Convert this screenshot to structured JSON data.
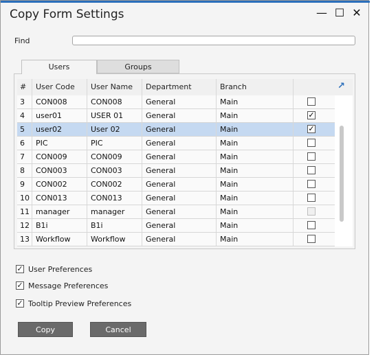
{
  "window": {
    "title": "Copy Form Settings",
    "min_glyph": "—",
    "max_glyph": "☐",
    "close_glyph": "✕"
  },
  "find": {
    "label": "Find",
    "value": ""
  },
  "tabs": [
    {
      "label": "Users",
      "active": true
    },
    {
      "label": "Groups",
      "active": false
    }
  ],
  "grid": {
    "columns": [
      "#",
      "User Code",
      "User Name",
      "Department",
      "Branch",
      ""
    ],
    "rows": [
      {
        "num": "3",
        "code": "CON008",
        "name": "CON008",
        "dept": "General",
        "branch": "Main",
        "checked": "",
        "selected": false,
        "disabled": false
      },
      {
        "num": "4",
        "code": "user01",
        "name": "USER 01",
        "dept": "General",
        "branch": "Main",
        "checked": "✓",
        "selected": false,
        "disabled": false
      },
      {
        "num": "5",
        "code": "user02",
        "name": "User 02",
        "dept": "General",
        "branch": "Main",
        "checked": "✓",
        "selected": true,
        "disabled": false
      },
      {
        "num": "6",
        "code": "PIC",
        "name": "PIC",
        "dept": "General",
        "branch": "Main",
        "checked": "",
        "selected": false,
        "disabled": false
      },
      {
        "num": "7",
        "code": "CON009",
        "name": "CON009",
        "dept": "General",
        "branch": "Main",
        "checked": "",
        "selected": false,
        "disabled": false
      },
      {
        "num": "8",
        "code": "CON003",
        "name": "CON003",
        "dept": "General",
        "branch": "Main",
        "checked": "",
        "selected": false,
        "disabled": false
      },
      {
        "num": "9",
        "code": "CON002",
        "name": "CON002",
        "dept": "General",
        "branch": "Main",
        "checked": "",
        "selected": false,
        "disabled": false
      },
      {
        "num": "10",
        "code": "CON013",
        "name": "CON013",
        "dept": "General",
        "branch": "Main",
        "checked": "",
        "selected": false,
        "disabled": false
      },
      {
        "num": "11",
        "code": "manager",
        "name": "manager",
        "dept": "General",
        "branch": "Main",
        "checked": "",
        "selected": false,
        "disabled": true
      },
      {
        "num": "12",
        "code": "B1i",
        "name": "B1i",
        "dept": "General",
        "branch": "Main",
        "checked": "",
        "selected": false,
        "disabled": false
      },
      {
        "num": "13",
        "code": "Workflow",
        "name": "Workflow",
        "dept": "General",
        "branch": "Main",
        "checked": "",
        "selected": false,
        "disabled": false
      }
    ]
  },
  "options": [
    {
      "label": "User Preferences",
      "checked": "✓"
    },
    {
      "label": "Message Preferences",
      "checked": "✓"
    },
    {
      "label": "Tooltip Preview Preferences",
      "checked": "✓"
    }
  ],
  "buttons": {
    "copy": "Copy",
    "cancel": "Cancel"
  }
}
